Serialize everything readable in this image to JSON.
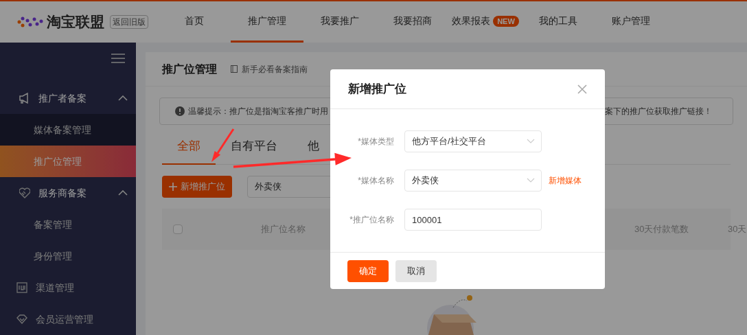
{
  "header": {
    "logo_text": "淘宝联盟",
    "old_version": "返回旧版",
    "nav": [
      {
        "label": "首页",
        "selected": false
      },
      {
        "label": "推广管理",
        "selected": true
      },
      {
        "label": "我要推广",
        "selected": false
      },
      {
        "label": "我要招商",
        "selected": false
      },
      {
        "label": "效果报表",
        "selected": false,
        "badge": "NEW"
      },
      {
        "label": "我的工具",
        "selected": false
      },
      {
        "label": "账户管理",
        "selected": false
      }
    ]
  },
  "sidebar": {
    "items": [
      {
        "label": "推广者备案",
        "kind": "group",
        "expanded": true,
        "selected": false,
        "children": [
          {
            "label": "媒体备案管理",
            "kind": "sub",
            "selected": false
          },
          {
            "label": "推广位管理",
            "kind": "sub",
            "selected": true
          }
        ]
      },
      {
        "label": "服务商备案",
        "kind": "group",
        "expanded": true,
        "selected": false,
        "children": [
          {
            "label": "备案管理",
            "kind": "sub",
            "selected": false
          },
          {
            "label": "身份管理",
            "kind": "sub",
            "selected": false
          }
        ]
      },
      {
        "label": "渠道管理",
        "kind": "group",
        "selected": false
      },
      {
        "label": "会员运营管理",
        "kind": "group",
        "selected": false
      }
    ]
  },
  "page": {
    "title": "推广位管理",
    "guide_link": "新手必看备案指南",
    "notice": {
      "left": "温馨提示：推广位是指淘宝客推广时用",
      "right": "案下的推广位获取推广链接！"
    },
    "tabs": [
      {
        "label": "全部",
        "selected": true
      },
      {
        "label": "自有平台",
        "selected": false
      },
      {
        "label": "他",
        "selected": false
      }
    ],
    "add_button": "新增推广位",
    "search": {
      "value": "外卖侠"
    },
    "table": {
      "select_all": {
        "checked": false
      },
      "columns": [
        "推广位名称",
        "30天付款笔数",
        "30天"
      ]
    }
  },
  "dialog": {
    "title": "新增推广位",
    "fields": [
      {
        "label": "*媒体类型",
        "kind": "select",
        "value": "他方平台/社交平台"
      },
      {
        "label": "*媒体名称",
        "kind": "select",
        "value": "外卖侠",
        "link": "新增媒体"
      },
      {
        "label": "*推广位名称",
        "kind": "input",
        "value": "100001"
      }
    ],
    "buttons": [
      {
        "label": "确定",
        "kind": "primary"
      },
      {
        "label": "取消",
        "kind": "secondary"
      }
    ]
  }
}
